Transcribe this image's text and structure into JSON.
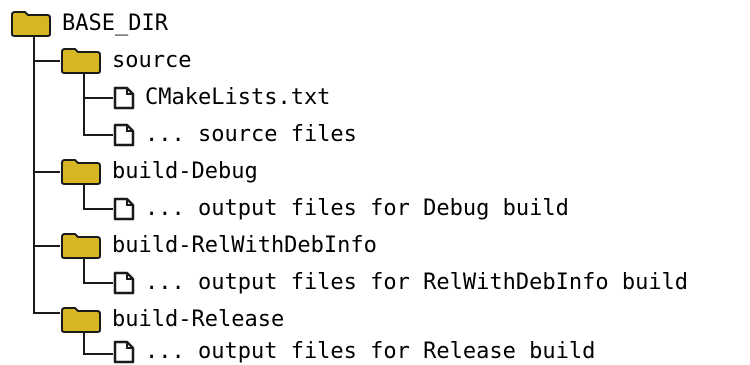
{
  "tree": {
    "root": {
      "label": "BASE_DIR",
      "icon": "folder-icon"
    },
    "items": [
      {
        "label": "source",
        "icon": "folder-icon"
      },
      {
        "label": "CMakeLists.txt",
        "icon": "file-icon"
      },
      {
        "label": "... source files",
        "icon": "file-icon"
      },
      {
        "label": "build-Debug",
        "icon": "folder-icon"
      },
      {
        "label": "... output files for Debug build",
        "icon": "file-icon"
      },
      {
        "label": "build-RelWithDebInfo",
        "icon": "folder-icon"
      },
      {
        "label": "... output files for RelWithDebInfo build",
        "icon": "file-icon"
      },
      {
        "label": "build-Release",
        "icon": "folder-icon"
      },
      {
        "label": "... output files for Release build",
        "icon": "file-icon"
      }
    ]
  },
  "colors": {
    "folder_fill": "#d6b623",
    "folder_stroke": "#1a1a1a",
    "line": "#1a1a1a",
    "text": "#000000"
  }
}
